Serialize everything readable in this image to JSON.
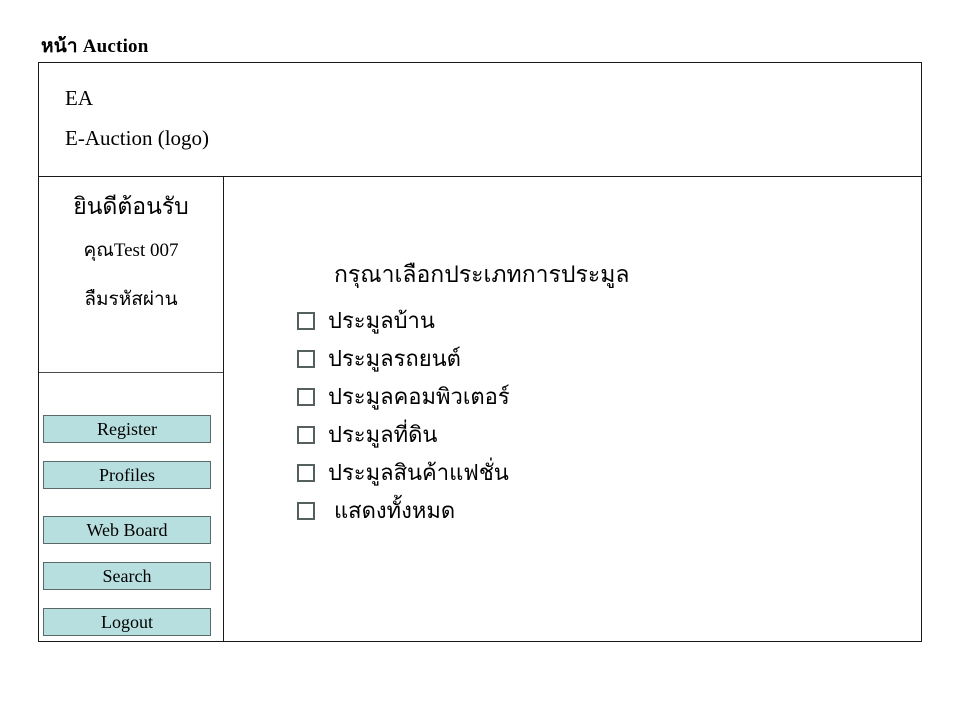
{
  "page": {
    "title": "หน้า Auction"
  },
  "header": {
    "logo_abbrev": "EA",
    "logo_fullname": "E-Auction (logo)"
  },
  "sidebar": {
    "welcome": {
      "greeting": "ยินดีต้อนรับ",
      "username": "คุณTest 007",
      "forgot_password": "ลืมรหัสผ่าน"
    },
    "buttons": [
      {
        "label": "Register"
      },
      {
        "label": "Profiles"
      },
      {
        "label": "Web Board"
      },
      {
        "label": "Search"
      },
      {
        "label": "Logout"
      }
    ]
  },
  "main": {
    "heading": "กรุณาเลือกประเภทการประมูล",
    "options": [
      {
        "label": "ประมูลบ้าน",
        "checked": false
      },
      {
        "label": "ประมูลรถยนต์",
        "checked": false
      },
      {
        "label": "ประมูลคอมพิวเตอร์",
        "checked": false
      },
      {
        "label": "ประมูลที่ดิน",
        "checked": false
      },
      {
        "label": "ประมูลสินค้าแฟชั่น",
        "checked": false
      },
      {
        "label": "แสดงทั้งหมด",
        "checked": false
      }
    ]
  },
  "colors": {
    "button_fill": "#b8dfe0",
    "button_border": "#5a6a6a",
    "frame_border": "#1a1a1a",
    "background": "#ffffff"
  }
}
